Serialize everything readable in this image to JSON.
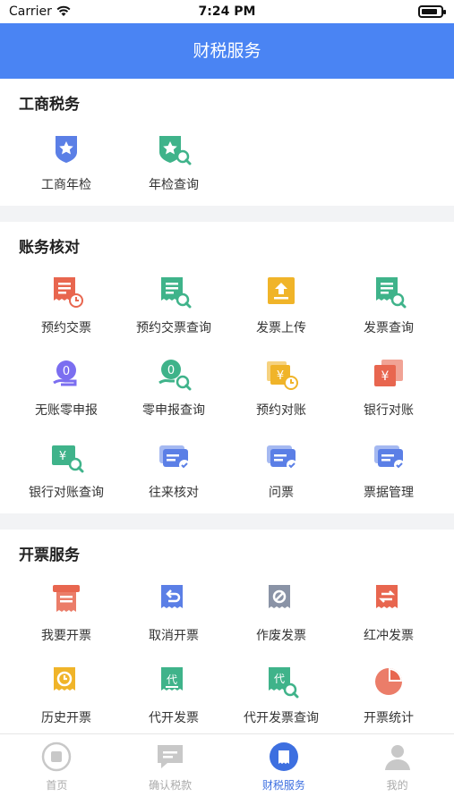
{
  "status": {
    "carrier": "Carrier",
    "time": "7:24 PM"
  },
  "nav": {
    "title": "财税服务"
  },
  "sections": [
    {
      "title": "工商税务",
      "items": [
        {
          "label": "工商年检",
          "icon": "badge-star-icon",
          "color": "#5b7fe6"
        },
        {
          "label": "年检查询",
          "icon": "badge-star-search-icon",
          "color": "#3fb38a"
        }
      ]
    },
    {
      "title": "账务核对",
      "items": [
        {
          "label": "预约交票",
          "icon": "receipt-clock-icon",
          "color": "#e8664f"
        },
        {
          "label": "预约交票查询",
          "icon": "receipt-search-icon",
          "color": "#3fb38a"
        },
        {
          "label": "发票上传",
          "icon": "receipt-upload-icon",
          "color": "#f0b429"
        },
        {
          "label": "发票查询",
          "icon": "receipt-search-icon",
          "color": "#3fb38a"
        },
        {
          "label": "无账零申报",
          "icon": "zero-hand-icon",
          "color": "#7b6ef0"
        },
        {
          "label": "零申报查询",
          "icon": "zero-search-icon",
          "color": "#3fb38a"
        },
        {
          "label": "预约对账",
          "icon": "yen-clock-icon",
          "color": "#f0b429"
        },
        {
          "label": "银行对账",
          "icon": "yen-cards-icon",
          "color": "#e8664f"
        },
        {
          "label": "银行对账查询",
          "icon": "yen-search-icon",
          "color": "#3fb38a"
        },
        {
          "label": "往来核对",
          "icon": "card-check-icon",
          "color": "#5b7fe6"
        },
        {
          "label": "问票",
          "icon": "card-check-icon",
          "color": "#5b7fe6"
        },
        {
          "label": "票据管理",
          "icon": "card-check-icon",
          "color": "#5b7fe6"
        }
      ]
    },
    {
      "title": "开票服务",
      "items": [
        {
          "label": "我要开票",
          "icon": "invoice-icon",
          "color": "#e8664f"
        },
        {
          "label": "取消开票",
          "icon": "undo-receipt-icon",
          "color": "#5b7fe6"
        },
        {
          "label": "作废发票",
          "icon": "void-receipt-icon",
          "color": "#8a93a6"
        },
        {
          "label": "红冲发票",
          "icon": "swap-receipt-icon",
          "color": "#e8664f"
        },
        {
          "label": "历史开票",
          "icon": "history-receipt-icon",
          "color": "#f0b429"
        },
        {
          "label": "代开发票",
          "icon": "proxy-receipt-icon",
          "color": "#3fb38a"
        },
        {
          "label": "代开发票查询",
          "icon": "proxy-search-icon",
          "color": "#3fb38a"
        },
        {
          "label": "开票统计",
          "icon": "pie-chart-icon",
          "color": "#e8664f"
        }
      ]
    }
  ],
  "tabs": [
    {
      "label": "首页",
      "icon": "home-icon"
    },
    {
      "label": "确认税款",
      "icon": "chat-icon"
    },
    {
      "label": "财税服务",
      "icon": "service-icon",
      "active": true
    },
    {
      "label": "我的",
      "icon": "user-icon"
    }
  ],
  "colors": {
    "accent": "#4a84f3",
    "tabActive": "#3d6fe0"
  }
}
